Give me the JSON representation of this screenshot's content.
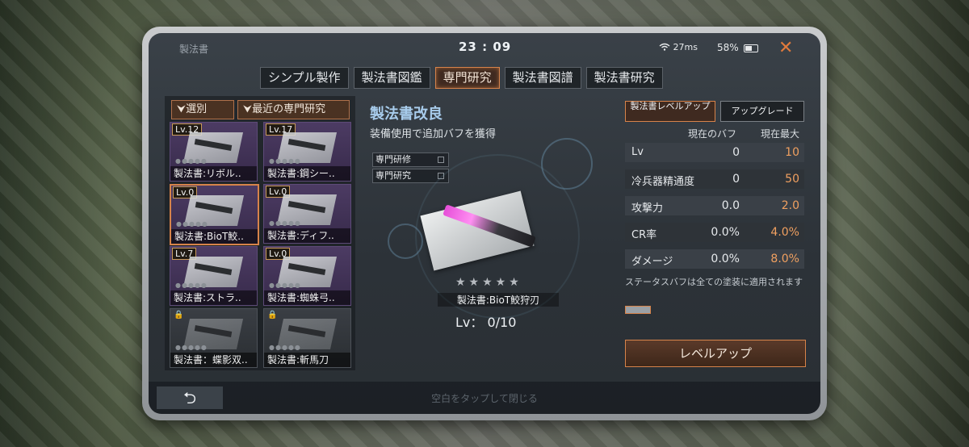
{
  "status": {
    "title": "製法書",
    "clock": "23 : 09",
    "ping": "27ms",
    "battery": "58%",
    "battery_level": 0.58
  },
  "tabs": [
    "シンプル製作",
    "製法書図鑑",
    "専門研究",
    "製法書図譜",
    "製法書研究"
  ],
  "active_tab": "専門研究",
  "left": {
    "sort_label": "選別",
    "recent_label": "最近の専門研究",
    "cards": [
      {
        "lv": "Lv.12",
        "name": "製法書:リボル..",
        "locked": false
      },
      {
        "lv": "Lv.17",
        "name": "製法書:鋼シー..",
        "locked": false
      },
      {
        "lv": "Lv.0",
        "name": "製法書:BioT鮫..",
        "locked": false,
        "selected": true
      },
      {
        "lv": "Lv.0",
        "name": "製法書:ディフ..",
        "locked": false
      },
      {
        "lv": "Lv.7",
        "name": "製法書:ストラ..",
        "locked": false
      },
      {
        "lv": "Lv.0",
        "name": "製法書:蜘蛛弓..",
        "locked": false
      },
      {
        "lv": "",
        "name": "製法書：蝶影双..",
        "locked": true
      },
      {
        "lv": "",
        "name": "製法書:斬馬刀",
        "locked": true
      }
    ]
  },
  "middle": {
    "title": "製法書改良",
    "subtitle": "装備使用で追加バフを獲得",
    "labels": [
      "専門研修",
      "専門研究"
    ],
    "stars": "★★★★★",
    "item_name": "製法書:BioT鮫狩刃",
    "level_text": "Lv： 0/10"
  },
  "right": {
    "btn_level": "製法書レベルアップ",
    "btn_upgrade": "アップグレード",
    "col_current": "現在のバフ",
    "col_max": "現在最大",
    "rows": [
      {
        "label": "Lv",
        "current": "0",
        "max": "10"
      },
      {
        "label": "冷兵器精通度",
        "current": "0",
        "max": "50"
      },
      {
        "label": "攻撃力",
        "current": "0.0",
        "max": "2.0"
      },
      {
        "label": "CR率",
        "current": "0.0%",
        "max": "4.0%"
      },
      {
        "label": "ダメージ",
        "current": "0.0%",
        "max": "8.0%"
      }
    ],
    "note": "ステータスバフは全ての塗装に適用されます",
    "levelup_label": "レベルアップ"
  },
  "bottom": {
    "back_icon": "back-arrow-icon",
    "hint": "空白をタップして閉じる"
  },
  "colors": {
    "accent": "#d7834a",
    "value_max": "#f0a060",
    "title_blue": "#a8ccec"
  }
}
